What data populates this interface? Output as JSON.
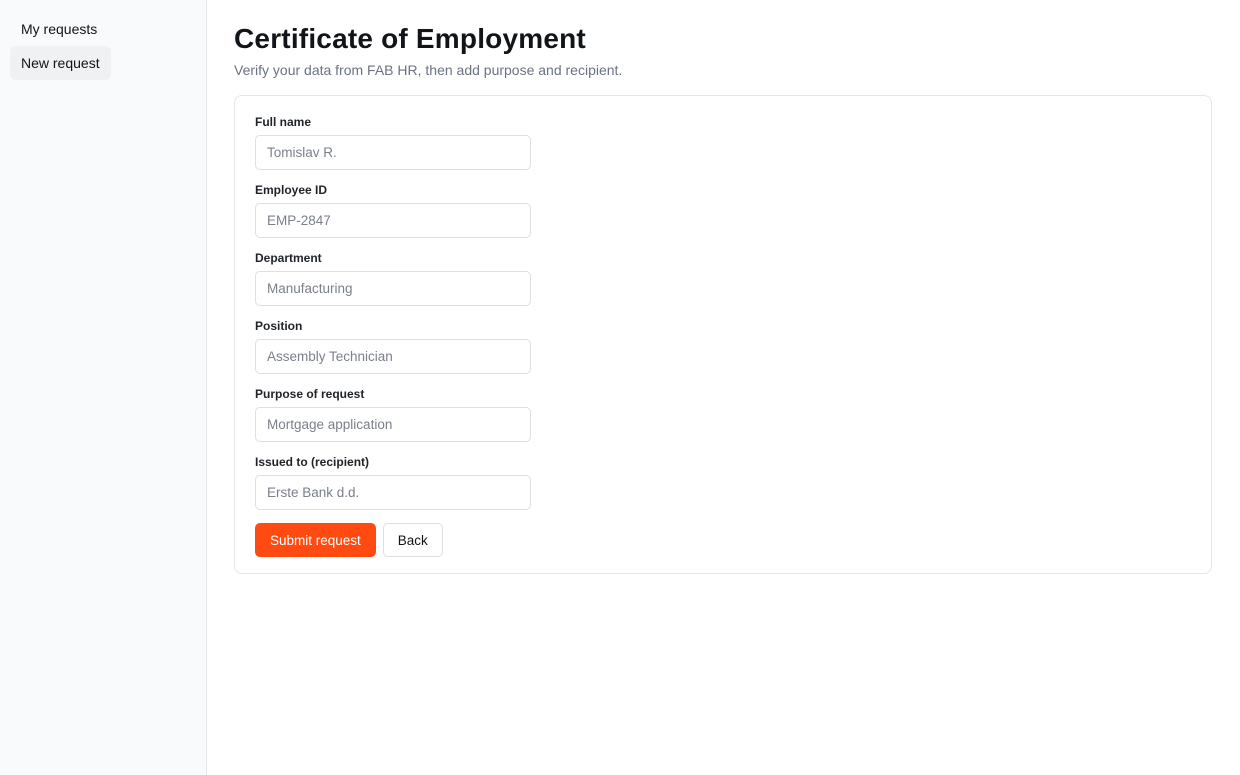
{
  "sidebar": {
    "items": [
      {
        "label": "My requests",
        "active": false
      },
      {
        "label": "New request",
        "active": true
      }
    ]
  },
  "header": {
    "title": "Certificate of Employment",
    "subtitle": "Verify your data from FAB HR, then add purpose and recipient."
  },
  "form": {
    "fields": [
      {
        "label": "Full name",
        "placeholder": "Tomislav R."
      },
      {
        "label": "Employee ID",
        "placeholder": "EMP-2847"
      },
      {
        "label": "Department",
        "placeholder": "Manufacturing"
      },
      {
        "label": "Position",
        "placeholder": "Assembly Technician"
      },
      {
        "label": "Purpose of request",
        "placeholder": "Mortgage application"
      },
      {
        "label": "Issued to (recipient)",
        "placeholder": "Erste Bank d.d."
      }
    ],
    "submit_label": "Submit request",
    "back_label": "Back"
  },
  "colors": {
    "accent": "#ff4a12",
    "sidebar_bg": "#f9fafb",
    "active_nav_bg": "#f0f1f3"
  }
}
